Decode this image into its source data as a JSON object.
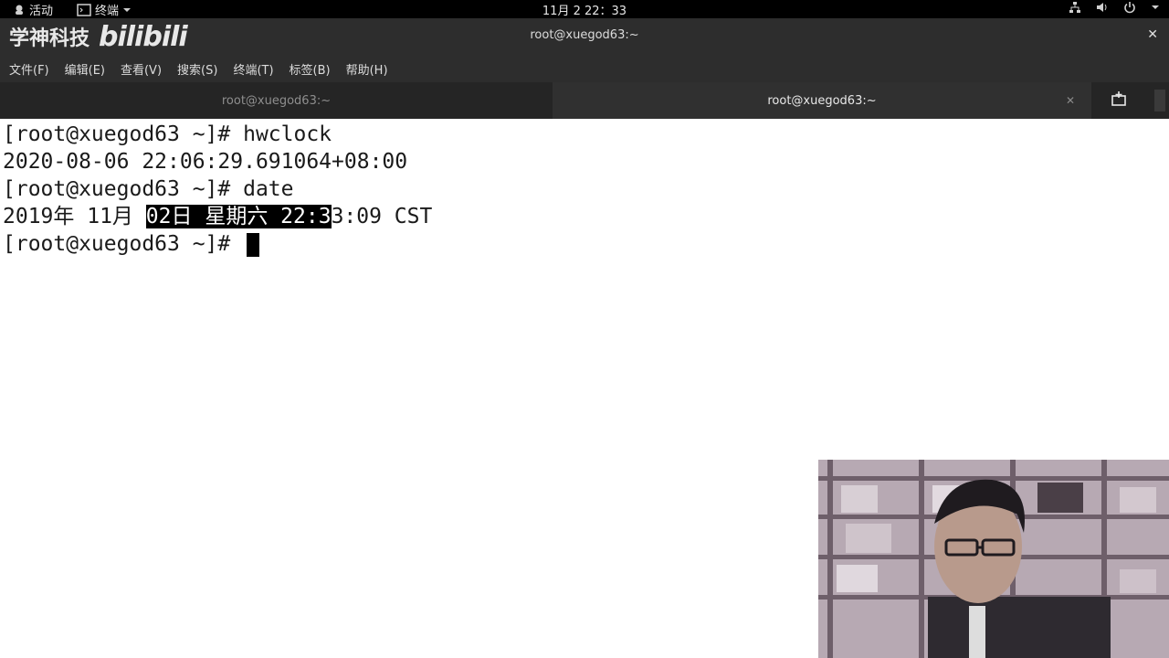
{
  "topbar": {
    "activities_label": "活动",
    "app_label": "终端",
    "clock": "11月 2  22：33"
  },
  "window": {
    "title": "root@xuegod63:~",
    "logo_text": "学神科技",
    "logo_brand": "bilibili"
  },
  "menu": [
    "文件(F)",
    "编辑(E)",
    "查看(V)",
    "搜索(S)",
    "终端(T)",
    "标签(B)",
    "帮助(H)"
  ],
  "tabs": [
    {
      "label": "root@xuegod63:~"
    },
    {
      "label": "root@xuegod63:~"
    }
  ],
  "terminal": {
    "line1": "[root@xuegod63 ~]# hwclock",
    "line2": "2020-08-06 22:06:29.691064+08:00",
    "line3": "[root@xuegod63 ~]# date",
    "line4_pre": "2019年 11月 ",
    "line4_sel": "02日 星期六 22:3",
    "line4_post": "3:09 CST",
    "line5": "[root@xuegod63 ~]# "
  },
  "colors": {
    "topbar_bg": "#000000",
    "chrome_bg": "#2d2d2d",
    "terminal_bg": "#ffffff",
    "terminal_fg": "#1a1a1a"
  }
}
